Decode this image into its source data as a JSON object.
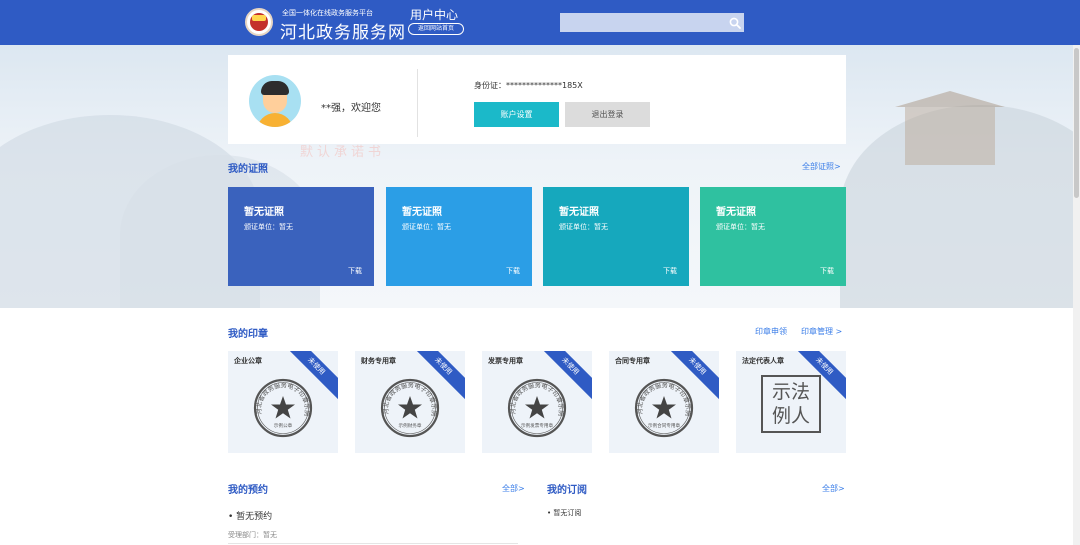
{
  "header": {
    "platform_tagline": "全国一体化在线政务服务平台",
    "site_name": "河北政务服务网",
    "user_center": "用户中心",
    "back_home": "返回网站首页",
    "search": {
      "value": "",
      "placeholder": ""
    },
    "bg_color": "#2f5bc4"
  },
  "profile": {
    "welcome": "**强，欢迎您",
    "id_card": "身份证：**************185X",
    "account_settings": "账户设置",
    "logout": "退出登录"
  },
  "watermark": "默认承诺书",
  "certificates": {
    "title": "我的证照",
    "all_link": "全部证照>",
    "items": [
      {
        "title": "暂无证照",
        "unit": "颁证单位：暂无",
        "download": "下载",
        "color": "#3a62bd"
      },
      {
        "title": "暂无证照",
        "unit": "颁证单位：暂无",
        "download": "下载",
        "color": "#2b9ee6"
      },
      {
        "title": "暂无证照",
        "unit": "颁证单位：暂无",
        "download": "下载",
        "color": "#16a8bd"
      },
      {
        "title": "暂无证照",
        "unit": "颁证单位：暂无",
        "download": "下载",
        "color": "#2fc1a0"
      }
    ]
  },
  "seals": {
    "title": "我的印章",
    "apply_link": "印章申领",
    "manage_link": "印章管理 >",
    "ribbon_text": "未使用",
    "items": [
      {
        "name": "企业公章",
        "center": "示例公章"
      },
      {
        "name": "财务专用章",
        "center": "示例财务章"
      },
      {
        "name": "发票专用章",
        "center": "示例发票专用章"
      },
      {
        "name": "合同专用章",
        "center": "示例合同专用章"
      },
      {
        "name": "法定代表人章",
        "legal": [
          "示",
          "法",
          "例",
          "人"
        ]
      }
    ],
    "seal_ring_text": "河北省政务服务电子印章示例"
  },
  "appointments": {
    "title": "我的预约",
    "all_link": "全部>",
    "item": "• 暂无预约",
    "dept": "受理部门：暂无"
  },
  "subscriptions": {
    "title": "我的订阅",
    "all_link": "全部>",
    "item": "• 暂无订阅"
  }
}
